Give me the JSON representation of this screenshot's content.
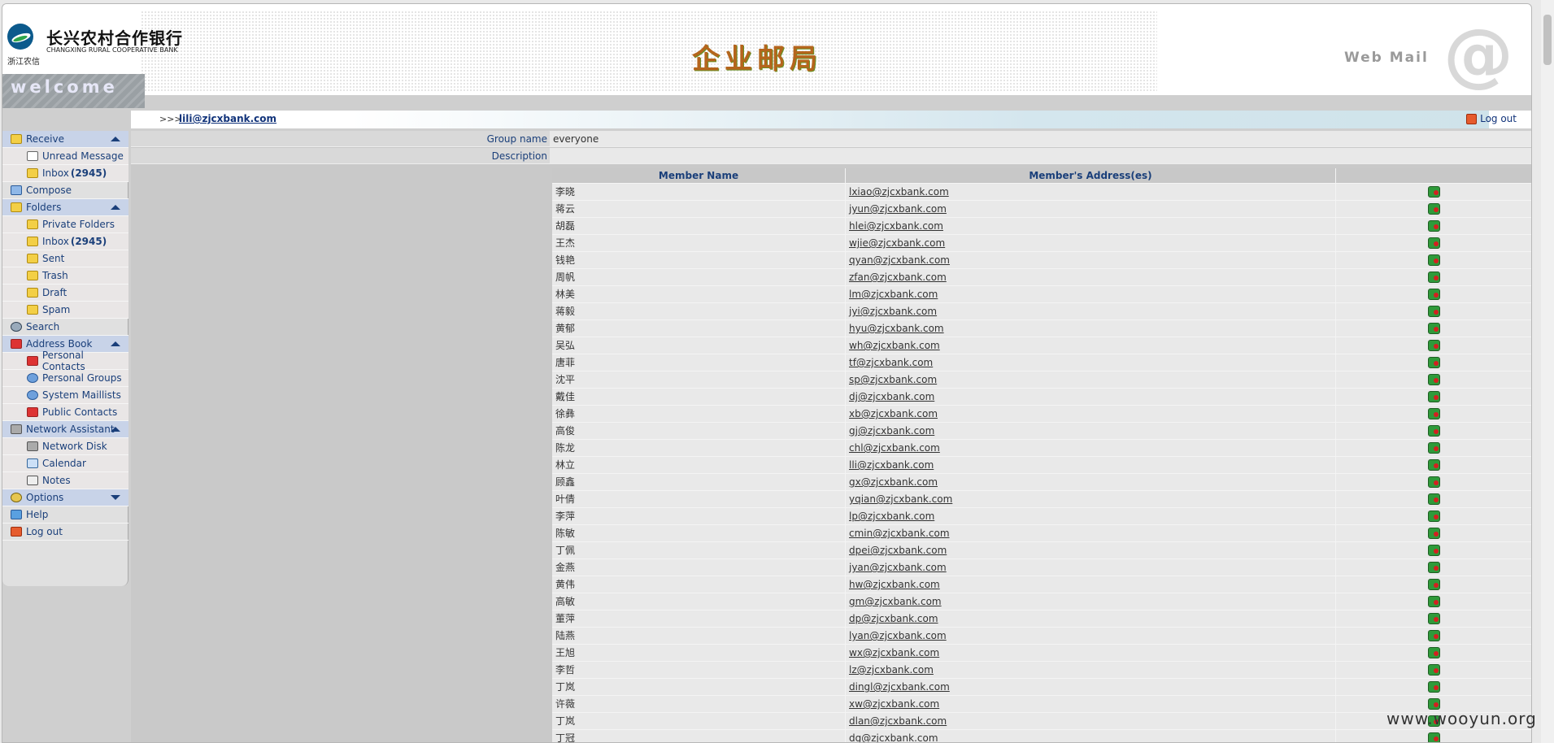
{
  "header": {
    "bank_name_cn": "长兴农村合作银行",
    "bank_name_en": "CHANGXING RURAL COOPERATIVE BANK",
    "logo_sub": "浙江农信",
    "title_cn": "企业邮局",
    "webmail_label": "Web Mail",
    "welcome_text": "welcome"
  },
  "userbar": {
    "prefix": ">>>",
    "email": "lili@zjcxbank.com",
    "logout_label": "Log out"
  },
  "sidebar": {
    "items": [
      {
        "label": "Receive",
        "type": "head",
        "arrow": "up",
        "icon": "receive-icon"
      },
      {
        "label": "Unread Message",
        "type": "sub",
        "icon": "envelope-icon"
      },
      {
        "label": "Inbox",
        "count": "(2945)",
        "type": "sub",
        "icon": "folder-icon"
      },
      {
        "label": "Compose",
        "type": "top",
        "icon": "compose-icon"
      },
      {
        "label": "Folders",
        "type": "head",
        "arrow": "up",
        "icon": "folders-icon"
      },
      {
        "label": "Private Folders",
        "type": "sub",
        "icon": "folder-icon"
      },
      {
        "label": "Inbox",
        "count": "(2945)",
        "type": "sub",
        "icon": "folder-icon"
      },
      {
        "label": "Sent",
        "type": "sub",
        "icon": "folder-icon"
      },
      {
        "label": "Trash",
        "type": "sub",
        "icon": "folder-icon"
      },
      {
        "label": "Draft",
        "type": "sub",
        "icon": "folder-icon"
      },
      {
        "label": "Spam",
        "type": "sub",
        "icon": "folder-icon"
      },
      {
        "label": "Search",
        "type": "top",
        "icon": "search-icon"
      },
      {
        "label": "Address Book",
        "type": "head",
        "arrow": "up",
        "icon": "address-book-icon"
      },
      {
        "label": "Personal Contacts",
        "type": "sub",
        "icon": "contacts-icon"
      },
      {
        "label": "Personal Groups",
        "type": "sub",
        "icon": "groups-icon"
      },
      {
        "label": "System Maillists",
        "type": "sub",
        "icon": "maillist-icon"
      },
      {
        "label": "Public Contacts",
        "type": "sub",
        "icon": "contacts-icon"
      },
      {
        "label": "Network Assistant",
        "type": "head",
        "arrow": "up",
        "icon": "network-icon"
      },
      {
        "label": "Network Disk",
        "type": "sub",
        "icon": "disk-icon"
      },
      {
        "label": "Calendar",
        "type": "sub",
        "icon": "calendar-icon"
      },
      {
        "label": "Notes",
        "type": "sub",
        "icon": "notes-icon"
      },
      {
        "label": "Options",
        "type": "head",
        "arrow": "down",
        "icon": "options-icon"
      },
      {
        "label": "Help",
        "type": "top",
        "icon": "help-icon"
      },
      {
        "label": "Log out",
        "type": "top",
        "icon": "logout-icon"
      }
    ]
  },
  "group": {
    "name_label": "Group name",
    "name_value": "everyone",
    "description_label": "Description",
    "description_value": ""
  },
  "members": {
    "columns": [
      "Member Name",
      "Member's Address(es)",
      ""
    ],
    "rows": [
      {
        "name": "李晓",
        "email": "lxiao@zjcxbank.com"
      },
      {
        "name": "蒋云",
        "email": "jyun@zjcxbank.com"
      },
      {
        "name": "胡磊",
        "email": "hlei@zjcxbank.com"
      },
      {
        "name": "王杰",
        "email": "wjie@zjcxbank.com"
      },
      {
        "name": "钱艳",
        "email": "qyan@zjcxbank.com"
      },
      {
        "name": "周帆",
        "email": "zfan@zjcxbank.com"
      },
      {
        "name": "林美",
        "email": "lm@zjcxbank.com"
      },
      {
        "name": "蒋毅",
        "email": "jyi@zjcxbank.com"
      },
      {
        "name": "黄郁",
        "email": "hyu@zjcxbank.com"
      },
      {
        "name": "吴弘",
        "email": "wh@zjcxbank.com"
      },
      {
        "name": "唐菲",
        "email": "tf@zjcxbank.com"
      },
      {
        "name": "沈平",
        "email": "sp@zjcxbank.com"
      },
      {
        "name": "戴佳",
        "email": "dj@zjcxbank.com"
      },
      {
        "name": "徐彝",
        "email": "xb@zjcxbank.com"
      },
      {
        "name": "高俊",
        "email": "gj@zjcxbank.com"
      },
      {
        "name": "陈龙",
        "email": "chl@zjcxbank.com"
      },
      {
        "name": "林立",
        "email": "lli@zjcxbank.com"
      },
      {
        "name": "顾鑫",
        "email": "gx@zjcxbank.com"
      },
      {
        "name": "叶倩",
        "email": "yqian@zjcxbank.com"
      },
      {
        "name": "李萍",
        "email": "lp@zjcxbank.com"
      },
      {
        "name": "陈敏",
        "email": "cmin@zjcxbank.com"
      },
      {
        "name": "丁佩",
        "email": "dpei@zjcxbank.com"
      },
      {
        "name": "金燕",
        "email": "jyan@zjcxbank.com"
      },
      {
        "name": "黄伟",
        "email": "hw@zjcxbank.com"
      },
      {
        "name": "高敏",
        "email": "gm@zjcxbank.com"
      },
      {
        "name": "董萍",
        "email": "dp@zjcxbank.com"
      },
      {
        "name": "陆燕",
        "email": "lyan@zjcxbank.com"
      },
      {
        "name": "王旭",
        "email": "wx@zjcxbank.com"
      },
      {
        "name": "李哲",
        "email": "lz@zjcxbank.com"
      },
      {
        "name": "丁岚",
        "email": "dingl@zjcxbank.com"
      },
      {
        "name": "许薇",
        "email": "xw@zjcxbank.com"
      },
      {
        "name": "丁岚",
        "email": "dlan@zjcxbank.com"
      },
      {
        "name": "丁冠",
        "email": "dg@zjcxbank.com"
      }
    ]
  },
  "watermark": "www.wooyun.org"
}
